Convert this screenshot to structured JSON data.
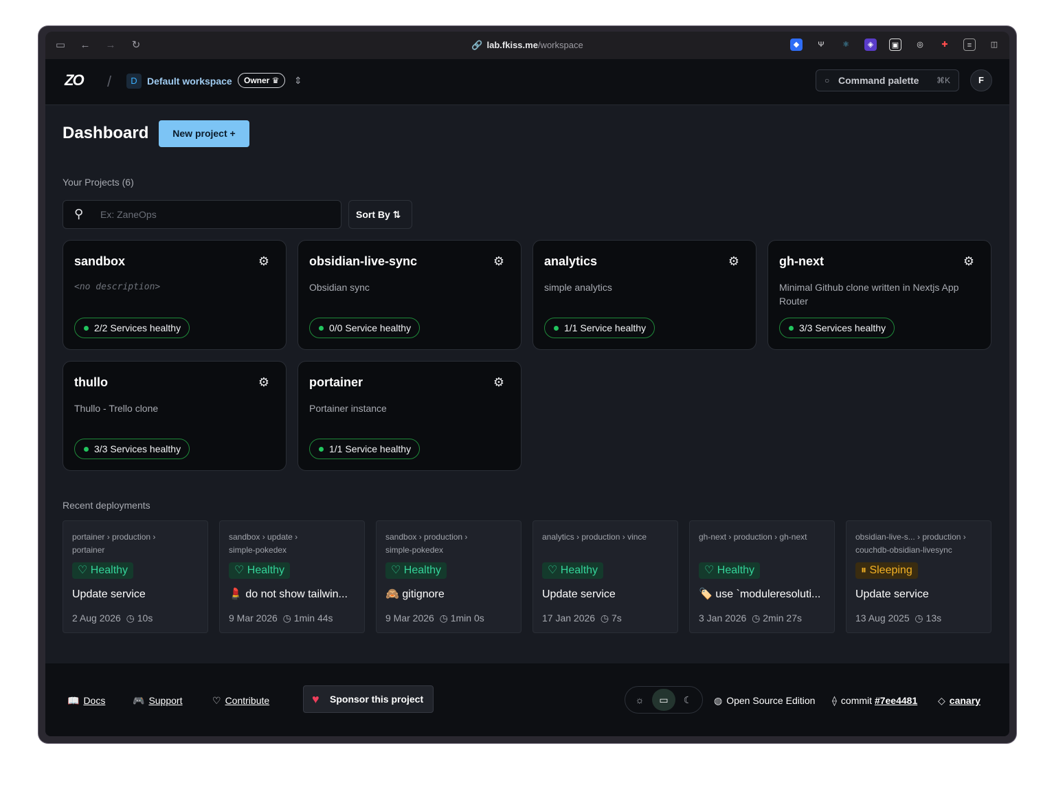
{
  "browser": {
    "url_host": "lab.fkiss.me",
    "url_path": "/workspace"
  },
  "header": {
    "logo": "ZO",
    "workspace_initial": "D",
    "workspace_name": "Default workspace",
    "workspace_role": "Owner ♛",
    "command_palette": "Command palette",
    "command_shortcut": "⌘K",
    "user_initial": "F"
  },
  "dashboard": {
    "title": "Dashboard",
    "new_project": "New project +",
    "projects_label": "Your Projects (6)",
    "search_placeholder": "Ex: ZaneOps",
    "sort_label": "Sort By ⇅"
  },
  "projects": [
    {
      "name": "sandbox",
      "description": "<no description>",
      "status": "2/2 Services healthy"
    },
    {
      "name": "obsidian-live-sync",
      "description": "Obsidian sync",
      "status": "0/0 Service healthy"
    },
    {
      "name": "analytics",
      "description": "simple analytics",
      "status": "1/1 Service healthy"
    },
    {
      "name": "gh-next",
      "description": "Minimal Github clone written in Nextjs App Router",
      "status": "3/3 Services healthy"
    },
    {
      "name": "thullo",
      "description": "Thullo - Trello clone",
      "status": "3/3 Services healthy"
    },
    {
      "name": "portainer",
      "description": "Portainer instance",
      "status": "1/1 Service healthy"
    }
  ],
  "deployments_label": "Recent deployments",
  "deployments": [
    {
      "crumb_a": "portainer",
      "crumb_b": "production",
      "crumb_c": "portainer",
      "status": "Healthy",
      "message": "Update service",
      "date": "2 Aug 2026",
      "duration": "10s"
    },
    {
      "crumb_a": "sandbox",
      "crumb_b": "update",
      "crumb_c": "simple-pokedex",
      "status": "Healthy",
      "message": "💄 do not show tailwin...",
      "date": "9 Mar 2026",
      "duration": "1min 44s"
    },
    {
      "crumb_a": "sandbox",
      "crumb_b": "production",
      "crumb_c": "simple-pokedex",
      "status": "Healthy",
      "message": "🙈 gitignore",
      "date": "9 Mar 2026",
      "duration": "1min 0s"
    },
    {
      "crumb_a": "analytics",
      "crumb_b": "production",
      "crumb_c": "vince",
      "status": "Healthy",
      "message": "Update service",
      "date": "17 Jan 2026",
      "duration": "7s"
    },
    {
      "crumb_a": "gh-next",
      "crumb_b": "production",
      "crumb_c": "gh-next",
      "status": "Healthy",
      "message": "🏷️ use `moduleresoluti...",
      "date": "3 Jan 2026",
      "duration": "2min 27s"
    },
    {
      "crumb_a": "obsidian-live-s...",
      "crumb_b": "production",
      "crumb_c": "couchdb-obsidian-livesync",
      "status": "Sleeping",
      "message": "Update service",
      "date": "13 Aug 2025",
      "duration": "13s"
    }
  ],
  "footer": {
    "docs": "Docs",
    "support": "Support",
    "contribute": "Contribute",
    "sponsor": "Sponsor this project",
    "edition": "Open Source Edition",
    "commit_label": "commit",
    "commit_hash": "#7ee4481",
    "channel": "canary"
  },
  "colors": {
    "accent": "#7cc4f5",
    "healthy": "#34d399",
    "sleeping": "#f5b324",
    "background": "#181b22"
  }
}
